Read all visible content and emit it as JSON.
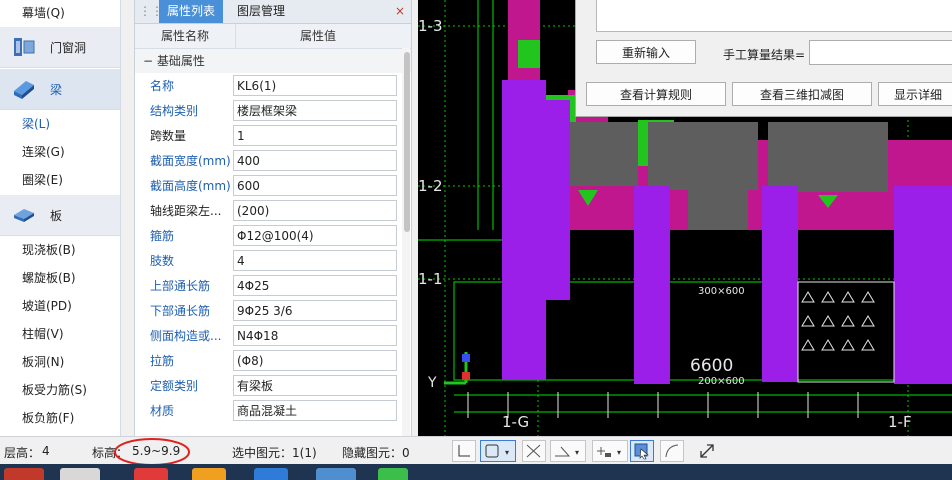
{
  "left_nav": {
    "top_item": "幕墙(Q)",
    "group_door": "门窗洞",
    "group_beam": "梁",
    "beam_items": [
      "梁(L)",
      "连梁(G)",
      "圈梁(E)"
    ],
    "group_slab": "板",
    "slab_items": [
      "现浇板(B)",
      "螺旋板(B)",
      "坡道(PD)",
      "柱帽(V)",
      "板洞(N)",
      "板受力筋(S)",
      "板负筋(F)"
    ]
  },
  "prop_panel": {
    "tab_active": "属性列表",
    "tab_inactive": "图层管理",
    "close": "×",
    "col_name": "属性名称",
    "col_value": "属性值",
    "section": "基础属性",
    "section_toggle": "−",
    "rows": [
      {
        "name": "名称",
        "value": "KL6(1)",
        "blue": true
      },
      {
        "name": "结构类别",
        "value": "楼层框架梁",
        "blue": true
      },
      {
        "name": "跨数量",
        "value": "1",
        "blue": false
      },
      {
        "name": "截面宽度(mm)",
        "value": "400",
        "blue": true
      },
      {
        "name": "截面高度(mm)",
        "value": "600",
        "blue": true
      },
      {
        "name": "轴线距梁左...",
        "value": "(200)",
        "blue": false
      },
      {
        "name": "箍筋",
        "value": "Φ12@100(4)",
        "blue": true
      },
      {
        "name": "肢数",
        "value": "4",
        "blue": true
      },
      {
        "name": "上部通长筋",
        "value": "4Φ25",
        "blue": true
      },
      {
        "name": "下部通长筋",
        "value": "9Φ25 3/6",
        "blue": true
      },
      {
        "name": "侧面构造或...",
        "value": "N4Φ18",
        "blue": true
      },
      {
        "name": "拉筋",
        "value": "(Φ8)",
        "blue": true
      },
      {
        "name": "定额类别",
        "value": "有梁板",
        "blue": true
      },
      {
        "name": "材质",
        "value": "商品混凝土",
        "blue": true
      }
    ]
  },
  "dialog": {
    "reinput": "重新输入",
    "manual_label": "手工算量结果=",
    "manual_value": "",
    "btn_rules": "查看计算规则",
    "btn_3d": "查看三维扣减图",
    "btn_detail": "显示详细"
  },
  "cad": {
    "axis_labels": [
      "1-3",
      "1-2",
      "1-1",
      "1-G",
      "1-F"
    ],
    "dim_text": "6600",
    "beam_label_1": "300×600",
    "beam_label_2": "200×600",
    "y_label": "Y",
    "colors": {
      "purple": "#9b1fe8",
      "magenta": "#c0178f",
      "green": "#22c41e",
      "gray": "#5e5e5e",
      "line_green": "#00e000",
      "axis_white": "#e6e6e6"
    }
  },
  "status": {
    "floor_height": "层高：",
    "floor_height_value": "4",
    "elevation": "标高：",
    "elevation_value": "5.9~9.9",
    "selected": "选中图元：1(1)",
    "hidden": "隐藏图元：0"
  }
}
